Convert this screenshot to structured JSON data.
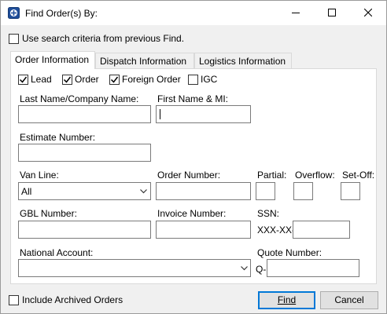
{
  "window": {
    "title": "Find Order(s) By:"
  },
  "use_previous": {
    "label": "Use search criteria from previous Find.",
    "checked": false
  },
  "tabs": [
    {
      "label": "Order Information",
      "active": true
    },
    {
      "label": "Dispatch Information",
      "active": false
    },
    {
      "label": "Logistics Information",
      "active": false
    }
  ],
  "order_types": [
    {
      "label": "Lead",
      "checked": true
    },
    {
      "label": "Order",
      "checked": true
    },
    {
      "label": "Foreign Order",
      "checked": true
    },
    {
      "label": "IGC",
      "checked": false
    }
  ],
  "fields": {
    "last_name_label": "Last Name/Company Name:",
    "last_name_value": "",
    "first_name_label": "First Name & MI:",
    "first_name_value": "",
    "estimate_label": "Estimate Number:",
    "estimate_value": "",
    "van_line_label": "Van Line:",
    "van_line_value": "All",
    "order_number_label": "Order Number:",
    "order_number_value": "",
    "partial_label": "Partial:",
    "partial_value": "",
    "overflow_label": "Overflow:",
    "overflow_value": "",
    "setoff_label": "Set-Off:",
    "setoff_value": "",
    "gbl_label": "GBL Number:",
    "gbl_value": "",
    "invoice_label": "Invoice Number:",
    "invoice_value": "",
    "ssn_label": "SSN:",
    "ssn_prefix": "XXX-XX-",
    "ssn_value": "",
    "national_account_label": "National Account:",
    "national_account_value": "",
    "quote_label": "Quote Number:",
    "quote_prefix": "Q-",
    "quote_value": ""
  },
  "include_archived": {
    "label": "Include Archived Orders",
    "checked": false
  },
  "buttons": {
    "find": "Find",
    "cancel": "Cancel"
  },
  "icons": {
    "app": "app-icon",
    "minimize": "minimize-icon",
    "maximize": "maximize-icon",
    "close": "close-icon"
  }
}
